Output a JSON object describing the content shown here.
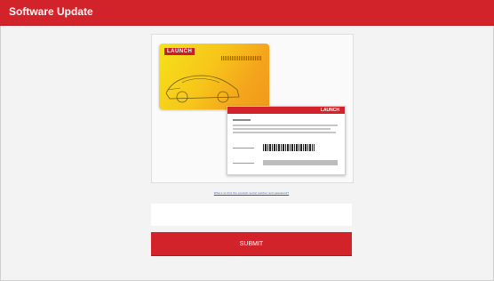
{
  "header": {
    "title": "Software Update",
    "bar_color": "#d2232a"
  },
  "card_illustration": {
    "brand_text": "LAUNCH",
    "card_colors": [
      "#f5e21a",
      "#f09a1d"
    ]
  },
  "registration": {
    "link_text": "Where to find the product serial number and password?",
    "serial_input_value": "",
    "submit_label": "SUBMIT"
  }
}
